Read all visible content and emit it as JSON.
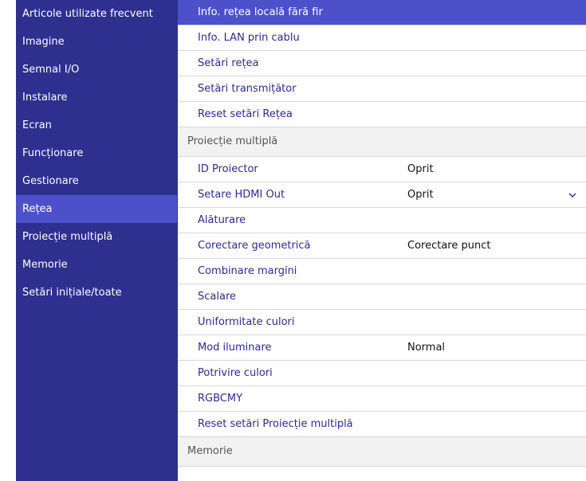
{
  "sidebar": {
    "items": [
      {
        "label": "Articole utilizate frecvent"
      },
      {
        "label": "Imagine"
      },
      {
        "label": "Semnal I/O"
      },
      {
        "label": "Instalare"
      },
      {
        "label": "Ecran"
      },
      {
        "label": "Funcționare"
      },
      {
        "label": "Gestionare"
      },
      {
        "label": "Rețea",
        "selected": true
      },
      {
        "label": "Proiecție multiplă"
      },
      {
        "label": "Memorie"
      },
      {
        "label": "Setări inițiale/toate"
      }
    ]
  },
  "main": {
    "network_rows": [
      {
        "label": "Info. rețea locală fără fir",
        "highlighted": true
      },
      {
        "label": "Info. LAN prin cablu"
      },
      {
        "label": "Setări rețea"
      },
      {
        "label": "Setări transmițător"
      },
      {
        "label": "Reset setări Rețea"
      }
    ],
    "section_multiprojection": "Proiecție multiplă",
    "multiprojection_rows": [
      {
        "label": "ID Proiector",
        "value": "Oprit"
      },
      {
        "label": "Setare HDMI Out",
        "value": "Oprit",
        "dropdown": true
      },
      {
        "label": "Alăturare"
      },
      {
        "label": "Corectare geometrică",
        "value": "Corectare punct"
      },
      {
        "label": "Combinare margini"
      },
      {
        "label": "Scalare"
      },
      {
        "label": "Uniformitate culori"
      },
      {
        "label": "Mod iluminare",
        "value": "Normal"
      },
      {
        "label": "Potrivire culori"
      },
      {
        "label": "RGBCMY"
      },
      {
        "label": "Reset setări Proiecție multiplă"
      }
    ],
    "section_memory": "Memorie"
  },
  "icons": {
    "dropdown": "chevron-down-icon"
  },
  "colors": {
    "sidebar_bg": "#2e2f8f",
    "highlight": "#4c51c9",
    "item_text": "#2b2c8e",
    "section_bg": "#f2f2f2"
  }
}
